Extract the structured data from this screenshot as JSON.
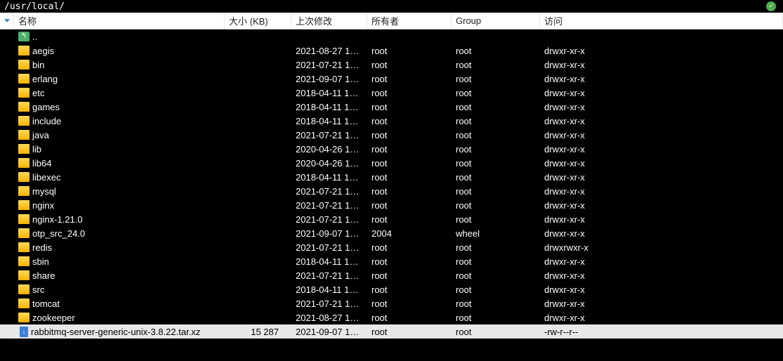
{
  "path": "/usr/local/",
  "columns": {
    "name": "名称",
    "size": "大小 (KB)",
    "modified": "上次修改",
    "owner": "所有者",
    "group": "Group",
    "perm": "访问"
  },
  "parent_label": "..",
  "entries": [
    {
      "icon": "folder",
      "name": "aegis",
      "size": "",
      "modified": "2021-08-27 1…",
      "owner": "root",
      "group": "root",
      "perm": "drwxr-xr-x",
      "selected": false
    },
    {
      "icon": "folder",
      "name": "bin",
      "size": "",
      "modified": "2021-07-21 1…",
      "owner": "root",
      "group": "root",
      "perm": "drwxr-xr-x",
      "selected": false
    },
    {
      "icon": "folder",
      "name": "erlang",
      "size": "",
      "modified": "2021-09-07 1…",
      "owner": "root",
      "group": "root",
      "perm": "drwxr-xr-x",
      "selected": false
    },
    {
      "icon": "folder",
      "name": "etc",
      "size": "",
      "modified": "2018-04-11 1…",
      "owner": "root",
      "group": "root",
      "perm": "drwxr-xr-x",
      "selected": false
    },
    {
      "icon": "folder",
      "name": "games",
      "size": "",
      "modified": "2018-04-11 1…",
      "owner": "root",
      "group": "root",
      "perm": "drwxr-xr-x",
      "selected": false
    },
    {
      "icon": "folder",
      "name": "include",
      "size": "",
      "modified": "2018-04-11 1…",
      "owner": "root",
      "group": "root",
      "perm": "drwxr-xr-x",
      "selected": false
    },
    {
      "icon": "folder",
      "name": "java",
      "size": "",
      "modified": "2021-07-21 1…",
      "owner": "root",
      "group": "root",
      "perm": "drwxr-xr-x",
      "selected": false
    },
    {
      "icon": "folder",
      "name": "lib",
      "size": "",
      "modified": "2020-04-26 1…",
      "owner": "root",
      "group": "root",
      "perm": "drwxr-xr-x",
      "selected": false
    },
    {
      "icon": "folder",
      "name": "lib64",
      "size": "",
      "modified": "2020-04-26 1…",
      "owner": "root",
      "group": "root",
      "perm": "drwxr-xr-x",
      "selected": false
    },
    {
      "icon": "folder",
      "name": "libexec",
      "size": "",
      "modified": "2018-04-11 1…",
      "owner": "root",
      "group": "root",
      "perm": "drwxr-xr-x",
      "selected": false
    },
    {
      "icon": "folder",
      "name": "mysql",
      "size": "",
      "modified": "2021-07-21 1…",
      "owner": "root",
      "group": "root",
      "perm": "drwxr-xr-x",
      "selected": false
    },
    {
      "icon": "folder",
      "name": "nginx",
      "size": "",
      "modified": "2021-07-21 1…",
      "owner": "root",
      "group": "root",
      "perm": "drwxr-xr-x",
      "selected": false
    },
    {
      "icon": "folder",
      "name": "nginx-1.21.0",
      "size": "",
      "modified": "2021-07-21 1…",
      "owner": "root",
      "group": "root",
      "perm": "drwxr-xr-x",
      "selected": false
    },
    {
      "icon": "folder",
      "name": "otp_src_24.0",
      "size": "",
      "modified": "2021-09-07 1…",
      "owner": "2004",
      "group": "wheel",
      "perm": "drwxr-xr-x",
      "selected": false
    },
    {
      "icon": "folder",
      "name": "redis",
      "size": "",
      "modified": "2021-07-21 1…",
      "owner": "root",
      "group": "root",
      "perm": "drwxrwxr-x",
      "selected": false
    },
    {
      "icon": "folder",
      "name": "sbin",
      "size": "",
      "modified": "2018-04-11 1…",
      "owner": "root",
      "group": "root",
      "perm": "drwxr-xr-x",
      "selected": false
    },
    {
      "icon": "folder",
      "name": "share",
      "size": "",
      "modified": "2021-07-21 1…",
      "owner": "root",
      "group": "root",
      "perm": "drwxr-xr-x",
      "selected": false
    },
    {
      "icon": "folder",
      "name": "src",
      "size": "",
      "modified": "2018-04-11 1…",
      "owner": "root",
      "group": "root",
      "perm": "drwxr-xr-x",
      "selected": false
    },
    {
      "icon": "folder",
      "name": "tomcat",
      "size": "",
      "modified": "2021-07-21 1…",
      "owner": "root",
      "group": "root",
      "perm": "drwxr-xr-x",
      "selected": false
    },
    {
      "icon": "folder",
      "name": "zookeeper",
      "size": "",
      "modified": "2021-08-27 1…",
      "owner": "root",
      "group": "root",
      "perm": "drwxr-xr-x",
      "selected": false
    },
    {
      "icon": "file",
      "name": "rabbitmq-server-generic-unix-3.8.22.tar.xz",
      "size": "15 287",
      "modified": "2021-09-07 1…",
      "owner": "root",
      "group": "root",
      "perm": "-rw-r--r--",
      "selected": true
    }
  ]
}
